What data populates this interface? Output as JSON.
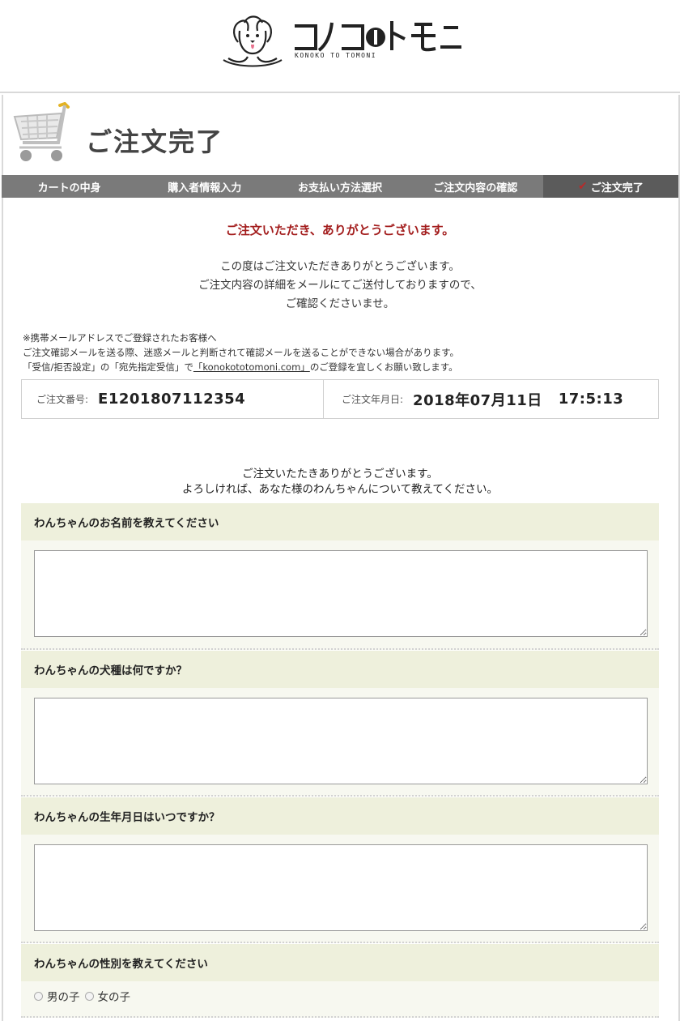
{
  "header": {
    "logo_text": "コノコトモニ",
    "logo_sub": "KONOKO TO TOMONI"
  },
  "page": {
    "title": "ご注文完了",
    "cart_icon": "shopping-cart-icon"
  },
  "steps": [
    {
      "label": "カートの中身",
      "active": false
    },
    {
      "label": "購入者情報入力",
      "active": false
    },
    {
      "label": "お支払い方法選択",
      "active": false
    },
    {
      "label": "ご注文内容の確認",
      "active": false
    },
    {
      "label": "ご注文完了",
      "active": true,
      "icon": "checkmark-icon"
    }
  ],
  "thanks": {
    "title": "ご注文いただき、ありがとうございます。",
    "line1": "この度はご注文いただきありがとうございます。",
    "line2": "ご注文内容の詳細をメールにてご送付しておりますので、",
    "line3": "ご確認くださいませ。"
  },
  "notice": {
    "line1": "※携帯メールアドレスでご登録されたお客様へ",
    "line2": "ご注文確認メールを送る際、迷惑メールと判断されて確認メールを送ることができない場合があります。",
    "line3_pre": "「受信/拒否設定」の「宛先指定受信」で",
    "line3_link": "「konokototomoni.com」",
    "line3_post": "のご登録を宜しくお願い致します。"
  },
  "order": {
    "number_label": "ご注文番号:",
    "number_value": "E1201807112354",
    "date_label": "ご注文年月日:",
    "date_value": "2018年07月11日",
    "time_value": "17:5:13"
  },
  "survey": {
    "intro1": "ご注文いたたきありがとうございます。",
    "intro2": "よろしければ、あなた様のわんちゃんについて教えてください。",
    "q1": "わんちゃんのお名前を教えてください",
    "q2": "わんちゃんの犬種は何ですか？",
    "q3": "わんちゃんの生年月日はいつですか？",
    "q4": "わんちゃんの性別を教えてください",
    "q4_option1": "男の子",
    "q4_option2": "女の子"
  },
  "colors": {
    "accent_red": "#a31d1d",
    "step_bar": "#7a7a7a",
    "question_bg": "#eef0dc"
  }
}
